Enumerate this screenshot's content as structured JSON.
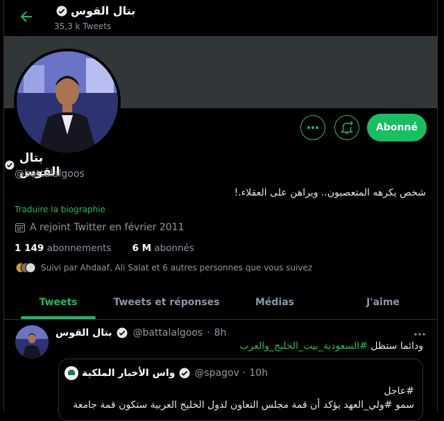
{
  "header": {
    "display_name": "بتال القوس",
    "tweet_count": "35,3 k Tweets"
  },
  "profile": {
    "display_name": "بتال القوس",
    "handle": "@battalalgoos",
    "bio": "شخص يكرهه المتعصبون.. ويراهن على العقلاء.!",
    "translate_label": "Traduire la biographie",
    "joined": "A rejoint Twitter en février 2011",
    "following_count": "1 149",
    "following_label": "abonnements",
    "followers_count": "6 M",
    "followers_label": "abonnés",
    "followed_by": "Suivi par Ahdaaf, Ali Salat et 6 autres personnes que vous suivez",
    "follow_button": "Abonné"
  },
  "tabs": [
    {
      "label": "Tweets",
      "active": true
    },
    {
      "label": "Tweets et réponses",
      "active": false
    },
    {
      "label": "Médias",
      "active": false
    },
    {
      "label": "J'aime",
      "active": false
    }
  ],
  "tweet": {
    "name": "بتال القوس",
    "handle": "@battalalgoos",
    "sep": "·",
    "time": "8h",
    "text_prefix": "ودائما ستظل ",
    "hashtag": "#السعودية_بيت_الخليج_والعرب",
    "quote": {
      "name": "واس الأخبار الملكية",
      "handle": "@spagov",
      "sep": "·",
      "time": "10h",
      "line1": "#عاجل",
      "line2": "سمو #ولي_العهد يؤكد أن قمة مجلس التعاون لدول الخليج العربية ستكون قمة جامعة"
    }
  },
  "colors": {
    "accent": "#17bf63",
    "background": "#000000",
    "banner": "#333639",
    "muted": "#8b98a5"
  },
  "icons": {
    "back": "arrow-left-icon",
    "verified": "verified-badge-icon",
    "more": "more-horizontal-icon",
    "notify": "bell-plus-icon",
    "calendar": "calendar-icon"
  }
}
